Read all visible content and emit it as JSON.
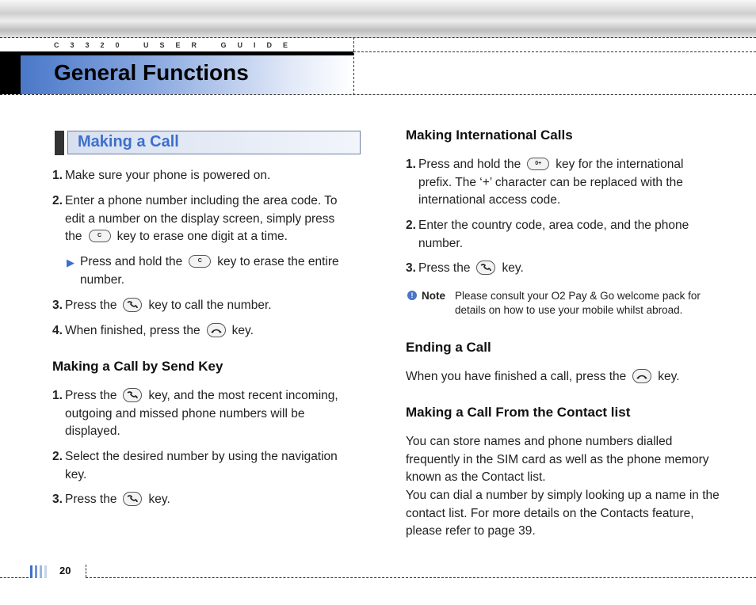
{
  "header": {
    "guide_label": "C3320 USER GUIDE",
    "page_title": "General Functions"
  },
  "left": {
    "section_title": "Making a Call",
    "steps": [
      {
        "num": "1.",
        "text": "Make sure your phone is powered on."
      },
      {
        "num": "2.",
        "text_a": "Enter a phone number including the area code. To edit a number on the display screen, simply press the",
        "key": "C",
        "text_b": "key to erase one digit at a time."
      },
      {
        "bullet_a": "Press and hold the",
        "key": "C",
        "bullet_b": "key to erase the entire number."
      },
      {
        "num": "3.",
        "text_a": "Press the",
        "key": "send-key-icon",
        "text_b": "key to call the number."
      },
      {
        "num": "4.",
        "text_a": "When finished, press the",
        "key": "end-key-icon",
        "text_b": "key."
      }
    ],
    "send_heading": "Making a Call by Send Key",
    "send_steps": [
      {
        "num": "1.",
        "text_a": "Press the",
        "key": "send-key-icon",
        "text_b": "key, and the most recent incoming, outgoing and missed phone numbers will be displayed."
      },
      {
        "num": "2.",
        "text": "Select the desired number by using the navigation key."
      },
      {
        "num": "3.",
        "text_a": "Press the",
        "key": "send-key-icon",
        "text_b": "key."
      }
    ]
  },
  "right": {
    "intl_heading": "Making International Calls",
    "intl_steps": [
      {
        "num": "1.",
        "text_a": "Press and hold the",
        "key": "0+",
        "text_b": "key for the international prefix. The ‘+’ character can be replaced with the international access code."
      },
      {
        "num": "2.",
        "text": "Enter the country code, area code, and the phone number."
      },
      {
        "num": "3.",
        "text_a": "Press the",
        "key": "send-key-icon",
        "text_b": "key."
      }
    ],
    "note": {
      "label": "Note",
      "text": "Please consult your O2 Pay & Go welcome pack for details on how to use your mobile whilst abroad."
    },
    "ending_heading": "Ending a Call",
    "ending_text_a": "When you have finished a call, press the",
    "ending_text_b": "key.",
    "contact_heading": "Making a Call From the Contact list",
    "contact_p1": "You can store names and phone numbers dialled frequently in the SIM card as well as the phone memory known as the Contact list.",
    "contact_p2": "You can dial a number by simply looking up a name in the contact list. For more details on the Contacts feature, please refer to page 39."
  },
  "footer": {
    "page_number": "20"
  },
  "colors": {
    "accent": "#3d6fcc",
    "banner_start": "#4a78c8"
  }
}
